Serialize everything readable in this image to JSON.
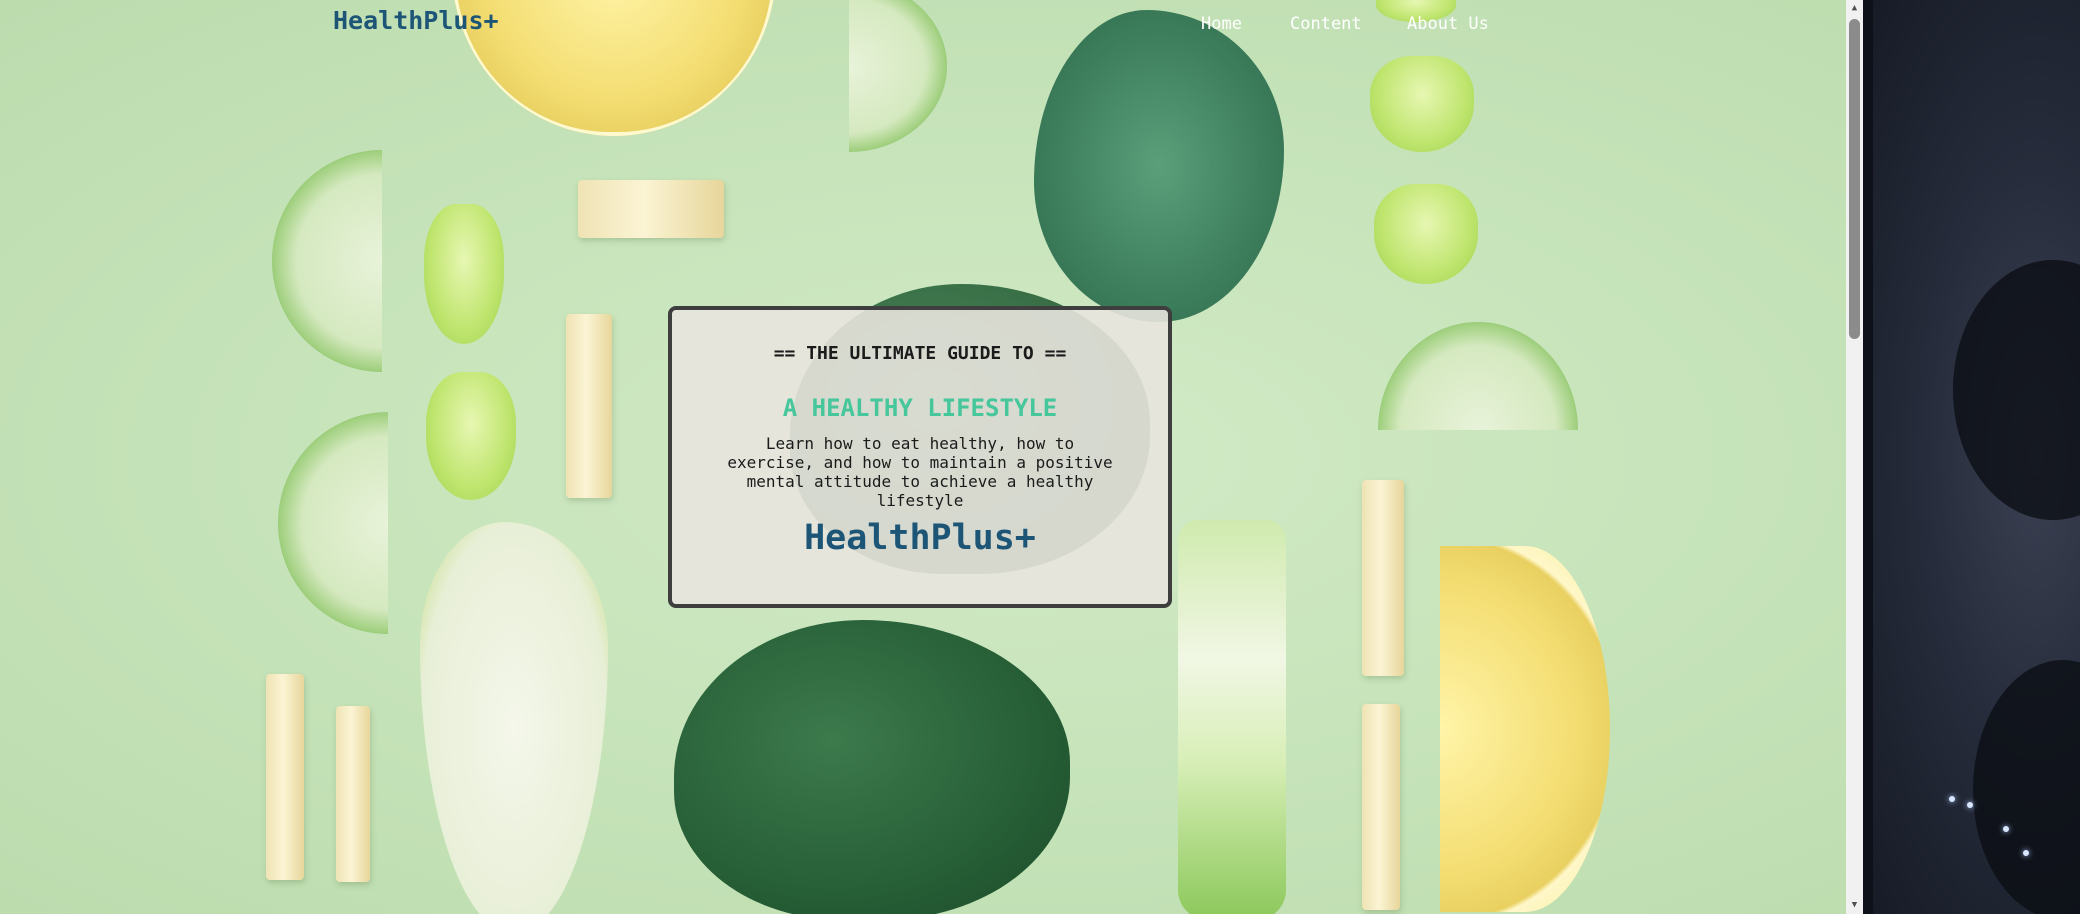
{
  "navbar": {
    "brand": "HealthPlus+",
    "links": [
      {
        "label": "Home"
      },
      {
        "label": "Content"
      },
      {
        "label": "About Us"
      }
    ]
  },
  "hero": {
    "kicker": "== THE ULTIMATE GUIDE TO ==",
    "headline": "A HEALTHY LIFESTYLE",
    "description": "Learn how to eat healthy, how to exercise, and how to maintain a positive mental attitude to achieve a healthy lifestyle",
    "brand": "HealthPlus+"
  },
  "colors": {
    "brand": "#1d5577",
    "headline_accent": "#45c79b",
    "background": "#c9e6bd",
    "card_border": "#3e3e3e"
  },
  "icons": {
    "scroll_up": "triangle-up",
    "scroll_down": "triangle-down"
  }
}
